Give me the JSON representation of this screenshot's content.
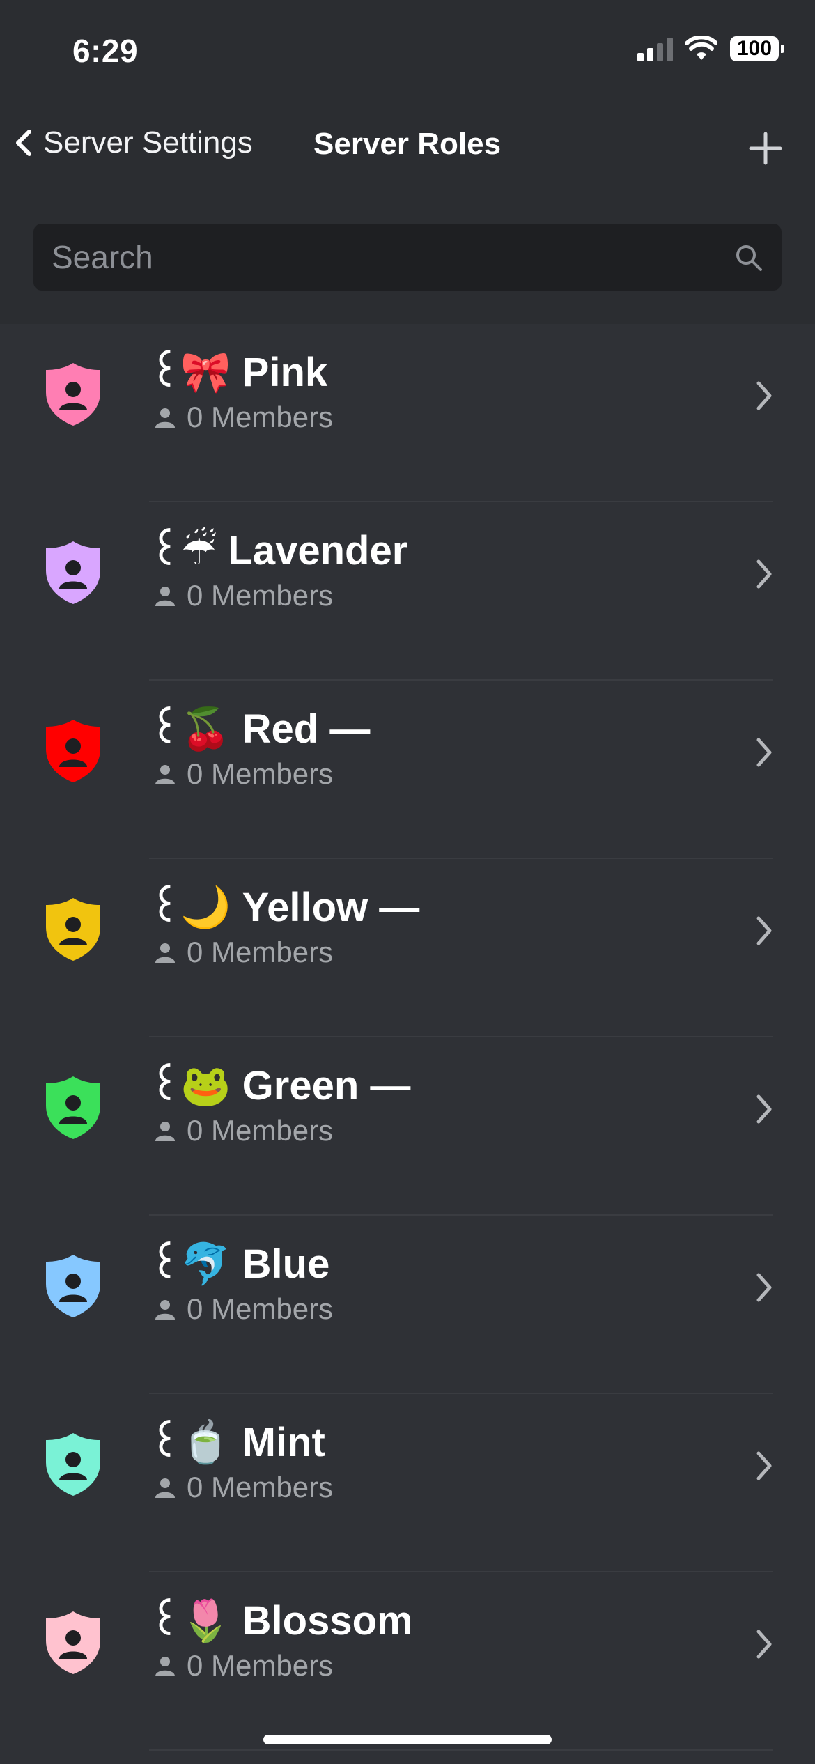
{
  "status": {
    "time": "6:29",
    "battery": "100"
  },
  "nav": {
    "back_label": "Server Settings",
    "title": "Server Roles"
  },
  "search": {
    "placeholder": "Search"
  },
  "roles": [
    {
      "name": "꒰🎀 Pink",
      "members": "0 Members",
      "color": "#ff7eb3"
    },
    {
      "name": "꒰☔ Lavender",
      "members": "0 Members",
      "color": "#d9a6ff"
    },
    {
      "name": "꒰🍒 Red —",
      "members": "0 Members",
      "color": "#ff0000"
    },
    {
      "name": "꒰🌙 Yellow —",
      "members": "0 Members",
      "color": "#f1c40f"
    },
    {
      "name": "꒰🐸 Green —",
      "members": "0 Members",
      "color": "#3be05a"
    },
    {
      "name": "꒰🐬 Blue",
      "members": "0 Members",
      "color": "#86c8ff"
    },
    {
      "name": "꒰🍵 Mint",
      "members": "0 Members",
      "color": "#7af2d6"
    },
    {
      "name": "꒰🌷 Blossom",
      "members": "0 Members",
      "color": "#ffc2cf"
    }
  ]
}
